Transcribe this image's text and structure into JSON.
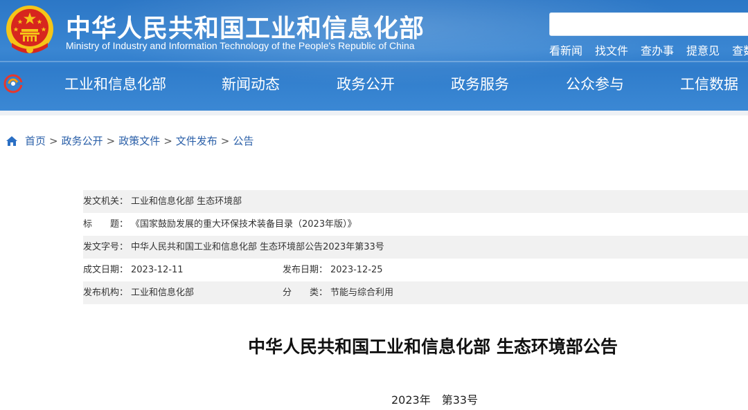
{
  "header": {
    "title": "中华人民共和国工业和信息化部",
    "subtitle": "Ministry of Industry and Information Technology of the People's Republic of China",
    "search": {
      "placeholder": ""
    },
    "quick_links": [
      "看新闻",
      "找文件",
      "查办事",
      "提意见",
      "查数"
    ]
  },
  "nav": {
    "items": [
      "工业和信息化部",
      "新闻动态",
      "政务公开",
      "政务服务",
      "公众参与",
      "工信数据"
    ]
  },
  "breadcrumb": [
    "首页",
    "政务公开",
    "政策文件",
    "文件发布",
    "公告"
  ],
  "breadcrumb_separator": ">",
  "info": {
    "issuer_label": "发文机关：",
    "issuer": "工业和信息化部 生态环境部",
    "title_label": "标　　题：",
    "title": "《国家鼓励发展的重大环保技术装备目录（2023年版）》",
    "doc_no_label": "发文字号：",
    "doc_no": "中华人民共和国工业和信息化部 生态环境部公告2023年第33号",
    "created_label": "成文日期：",
    "created": "2023-12-11",
    "published_label": "发布日期：",
    "published": "2023-12-25",
    "agency_label": "发布机构：",
    "agency": "工业和信息化部",
    "category_label": "分　　类：",
    "category": "节能与综合利用"
  },
  "document": {
    "title": "中华人民共和国工业和信息化部 生态环境部公告",
    "number": "2023年　第33号"
  },
  "colors": {
    "header_blue": "#2f7ccb",
    "link_blue": "#2a5fa8",
    "row_shade": "#f1f1f1",
    "emblem_red": "#d7261e",
    "emblem_gold": "#f5c518"
  },
  "icons": {
    "home": "home-icon",
    "emblem": "national-emblem",
    "nav_logo": "miit-logo-icon"
  }
}
